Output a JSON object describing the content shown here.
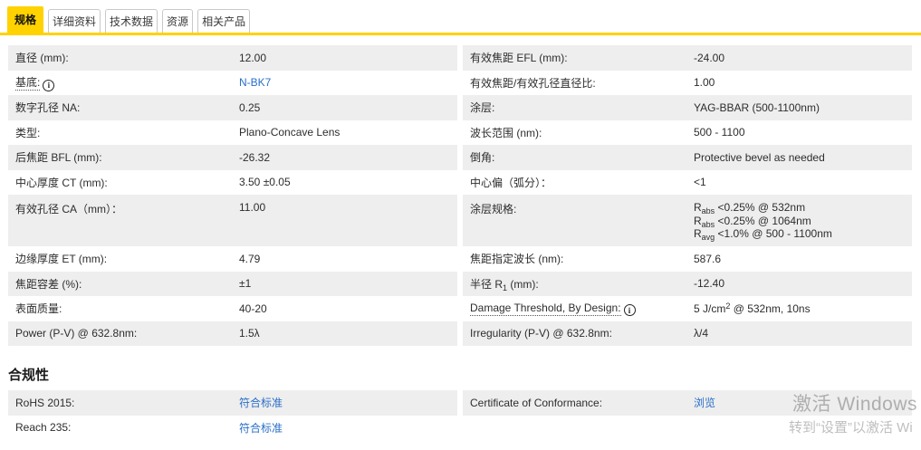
{
  "colors": {
    "accent_yellow": "#ffd200",
    "link_blue": "#2a6fc9",
    "row_gray": "#eeeeee"
  },
  "tabs": [
    {
      "label": "规格",
      "active": true
    },
    {
      "label": "详细资料",
      "active": false
    },
    {
      "label": "技术数据",
      "active": false
    },
    {
      "label": "资源",
      "active": false
    },
    {
      "label": "相关产品",
      "active": false
    }
  ],
  "specs": {
    "left": [
      {
        "label": "直径 (mm):",
        "value": "12.00"
      },
      {
        "label": "基底:",
        "info": true,
        "value": "N-BK7",
        "link": true
      },
      {
        "label": "数字孔径 NA:",
        "value": "0.25"
      },
      {
        "label": "类型:",
        "value": "Plano-Concave Lens"
      },
      {
        "label": "后焦距 BFL (mm):",
        "value": "-26.32"
      },
      {
        "label": "中心厚度 CT (mm):",
        "value": "3.50 ±0.05"
      },
      {
        "label": "有效孔径 CA（mm）：",
        "value": "11.00",
        "tall": true
      },
      {
        "label": "边缘厚度 ET (mm):",
        "value": "4.79"
      },
      {
        "label": "焦距容差 (%):",
        "value": "±1"
      },
      {
        "label": "表面质量:",
        "value": "40-20"
      },
      {
        "label": "Power (P-V) @ 632.8nm:",
        "value": "1.5λ"
      }
    ],
    "right": [
      {
        "label": "有效焦距 EFL (mm):",
        "value": "-24.00"
      },
      {
        "label": "有效焦距/有效孔径直径比:",
        "value": "1.00"
      },
      {
        "label": "涂层:",
        "value": "YAG-BBAR (500-1100nm)"
      },
      {
        "label": "波长范围 (nm):",
        "value": "500 - 1100"
      },
      {
        "label": "倒角:",
        "value": "Protective bevel as needed"
      },
      {
        "label": "中心偏（弧分）：",
        "value": "<1"
      },
      {
        "label": "涂层规格:",
        "tall": true,
        "lines": [
          [
            {
              "t": "R"
            },
            {
              "sub": "abs"
            },
            {
              "t": " <0.25% @ 532nm"
            }
          ],
          [
            {
              "t": "R"
            },
            {
              "sub": "abs"
            },
            {
              "t": " <0.25% @ 1064nm"
            }
          ],
          [
            {
              "t": "R"
            },
            {
              "sub": "avg"
            },
            {
              "t": " <1.0% @ 500 - 1100nm"
            }
          ]
        ]
      },
      {
        "label": "焦距指定波长 (nm):",
        "value": "587.6"
      },
      {
        "label_rich": [
          {
            "t": "半径 R"
          },
          {
            "sub": "1"
          },
          {
            "t": " (mm):"
          }
        ],
        "value": "-12.40"
      },
      {
        "label": "Damage Threshold, By Design:",
        "info": true,
        "value_rich": [
          {
            "t": "5 J/cm"
          },
          {
            "sup": "2"
          },
          {
            "t": " @ 532nm, 10ns"
          }
        ]
      },
      {
        "label": "Irregularity (P-V) @ 632.8nm:",
        "value": "λ/4"
      }
    ]
  },
  "compliance": {
    "heading": "合规性",
    "left": [
      {
        "label": "RoHS 2015:",
        "value": "符合标准",
        "link": true
      },
      {
        "label": "Reach 235:",
        "value": "符合标准",
        "link": true
      }
    ],
    "right": [
      {
        "label": "Certificate of Conformance:",
        "value": "浏览",
        "link": true
      }
    ]
  },
  "watermark": {
    "line1": "激活 Windows",
    "line2": "转到“设置”以激活 Wi"
  }
}
